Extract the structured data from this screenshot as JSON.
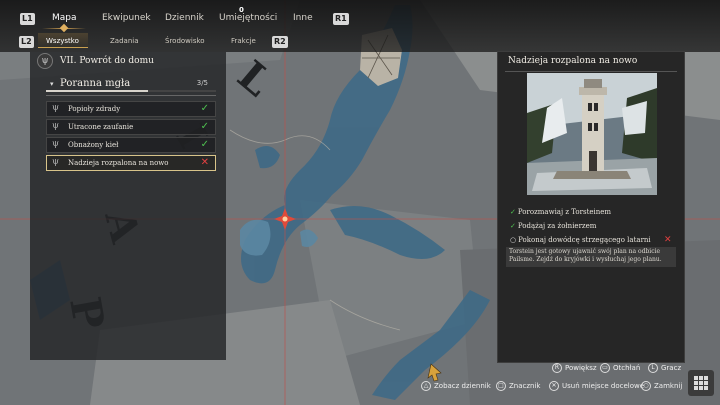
{
  "nav": {
    "l1": "L1",
    "r1": "R1",
    "tabs": [
      {
        "label": "Mapa",
        "active": true
      },
      {
        "label": "Ekwipunek"
      },
      {
        "label": "Dziennik"
      },
      {
        "label": "Umiejętności",
        "badge": "0"
      },
      {
        "label": "Inne"
      }
    ],
    "l2": "L2",
    "r2": "R2",
    "subtabs": [
      {
        "label": "Wszystko",
        "active": true
      },
      {
        "label": "Zadania"
      },
      {
        "label": "Środowisko"
      },
      {
        "label": "Frakcje"
      }
    ]
  },
  "quest_panel": {
    "chapter": "VII. Powrót do domu",
    "quest": {
      "name": "Poranna mgła",
      "count": "3/5",
      "progress": 0.6
    },
    "objectives": [
      {
        "label": "Popioły zdrady",
        "status": "done"
      },
      {
        "label": "Utracone zaufanie",
        "status": "done"
      },
      {
        "label": "Obnażony kieł",
        "status": "done"
      },
      {
        "label": "Nadzieja rozpalona na nowo",
        "status": "failed",
        "selected": true
      }
    ]
  },
  "detail": {
    "title": "Nadzieja rozpalona na nowo",
    "tasks": [
      {
        "label": "Porozmawiaj z Torsteinem",
        "status": "done"
      },
      {
        "label": "Podążaj za żołnierzem",
        "status": "done"
      },
      {
        "label": "Pokonaj dowódcę strzegącego latarni",
        "status": "failed"
      }
    ],
    "description": "Torstein jest gotowy ujawnić swój plan na odbicie Pailsme. Zejdź do kryjówki i wysłuchaj jego planu."
  },
  "map": {
    "region_letters": [
      "P",
      "A",
      "I",
      "L"
    ]
  },
  "hints": {
    "zoom": "Powiększ",
    "abyss": "Otchłań",
    "player": "Gracz",
    "journal": "Zobacz dziennik",
    "marker": "Znacznik",
    "remove_waypoint": "Usuń miejsce docelowe",
    "close": "Zamknij"
  },
  "colors": {
    "accent": "#d4a352",
    "done": "#4ec050",
    "failed": "#e04040",
    "water": "#3f6a86"
  }
}
